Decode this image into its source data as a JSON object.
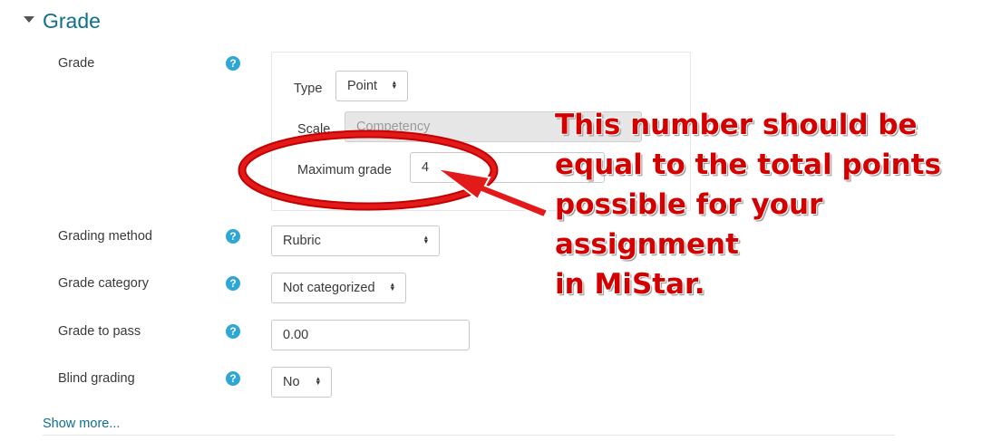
{
  "section": {
    "title": "Grade"
  },
  "fields": {
    "grade": {
      "label": "Grade"
    },
    "type": {
      "label": "Type",
      "value": "Point"
    },
    "scale": {
      "label": "Scale",
      "value": "Competency"
    },
    "max_grade": {
      "label": "Maximum grade",
      "value": "4"
    },
    "grading_method": {
      "label": "Grading method",
      "value": "Rubric"
    },
    "grade_category": {
      "label": "Grade category",
      "value": "Not categorized"
    },
    "grade_to_pass": {
      "label": "Grade to pass",
      "value": "0.00"
    },
    "blind_grading": {
      "label": "Blind grading",
      "value": "No"
    }
  },
  "help_glyph": "?",
  "select_arrows": "▲▼",
  "show_more": "Show more...",
  "annotation": {
    "lines": [
      "This number should be",
      "equal to the total points",
      "possible for your assignment",
      "in MiStar."
    ],
    "color": "#d40000"
  },
  "colors": {
    "link": "#0f6f8c",
    "help": "#2ea7d6"
  }
}
